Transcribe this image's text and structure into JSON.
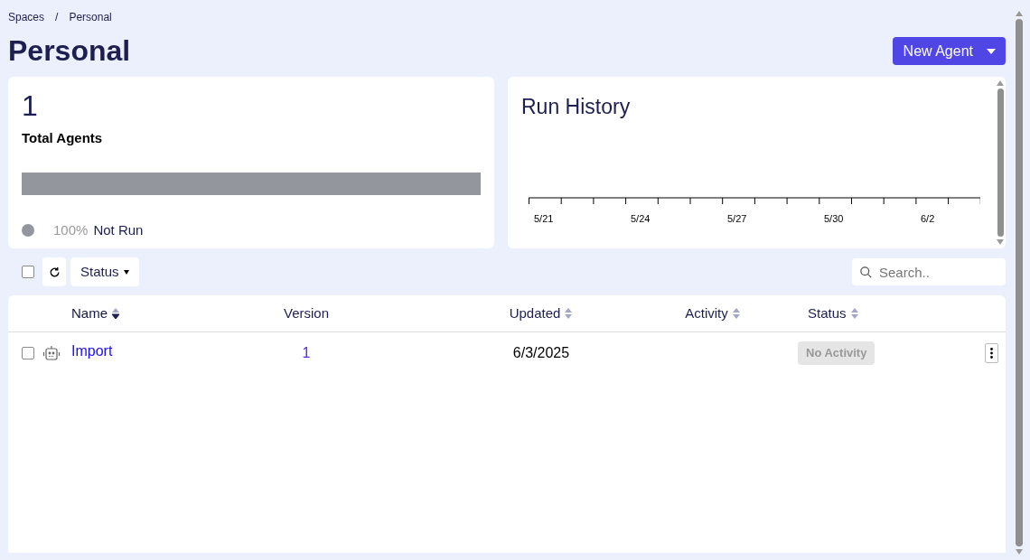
{
  "breadcrumb": [
    "Spaces",
    "/",
    "Personal"
  ],
  "title": "Personal",
  "new_button": {
    "label": "New Agent"
  },
  "summary": {
    "count": "1",
    "label": "Total Agents",
    "level": 1,
    "legend": [
      {
        "percent": "100%",
        "label": "Not Run",
        "color": "#94969e"
      }
    ]
  },
  "run_history": {
    "title": "Run History",
    "axis_labels": [
      "5/21",
      "5/24",
      "5/27",
      "5/30",
      "6/2"
    ]
  },
  "toolbar": {
    "select_all": {
      "checked": false
    },
    "filter": "Status",
    "search": {
      "placeholder": "Search.."
    }
  },
  "table": {
    "columns": [
      {
        "label": "Name",
        "sorted": true
      },
      {
        "label": "Version"
      },
      {
        "label": "Updated",
        "sorted": false
      },
      {
        "label": "Activity",
        "sorted": false
      },
      {
        "label": "Status",
        "sorted": false
      }
    ],
    "rows": [
      {
        "checked": false,
        "name": "Import",
        "version": "1",
        "updated": "6/3/2025",
        "status": "No Activity"
      }
    ]
  }
}
